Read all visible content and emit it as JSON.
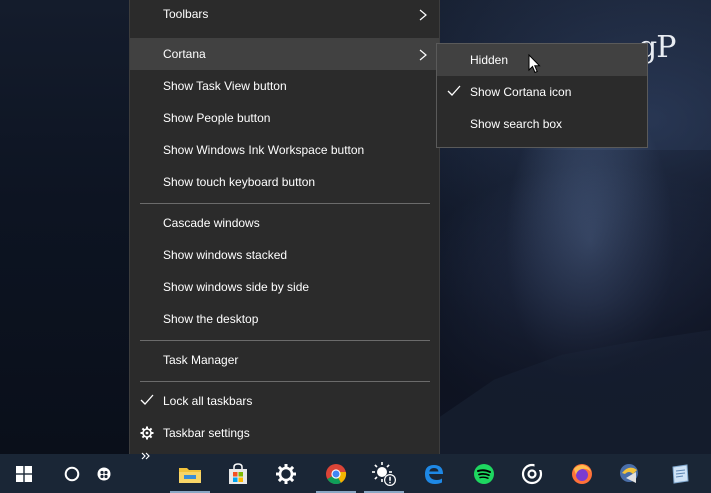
{
  "menu": {
    "items": [
      {
        "label": "Toolbars",
        "submenu": true
      },
      {
        "label": "Cortana",
        "submenu": true,
        "highlighted": true
      },
      {
        "label": "Show Task View button"
      },
      {
        "label": "Show People button"
      },
      {
        "label": "Show Windows Ink Workspace button"
      },
      {
        "label": "Show touch keyboard button"
      },
      {
        "label": "Cascade windows"
      },
      {
        "label": "Show windows stacked"
      },
      {
        "label": "Show windows side by side"
      },
      {
        "label": "Show the desktop"
      },
      {
        "label": "Task Manager"
      },
      {
        "label": "Lock all taskbars",
        "checked": true
      },
      {
        "label": "Taskbar settings",
        "icon": "gear-icon"
      }
    ]
  },
  "submenu": {
    "items": [
      {
        "label": "Hidden",
        "highlighted": true
      },
      {
        "label": "Show Cortana icon",
        "checked": true
      },
      {
        "label": "Show search box"
      }
    ]
  },
  "watermark": {
    "text": "gP"
  },
  "taskbar": {
    "icons": [
      "windows-start-icon",
      "cortana-icon",
      "people-icon",
      "overflow-chevron-icon",
      "file-explorer-icon",
      "microsoft-store-icon",
      "settings-gear-icon",
      "chrome-icon",
      "weather-alert-icon",
      "edge-icon",
      "spotify-icon",
      "groove-music-icon",
      "firefox-icon",
      "media-player-icon",
      "notes-icon"
    ]
  },
  "colors": {
    "menu_bg": "#2b2b2b",
    "menu_highlight": "#414141",
    "taskbar_bg": "#1a2636"
  }
}
